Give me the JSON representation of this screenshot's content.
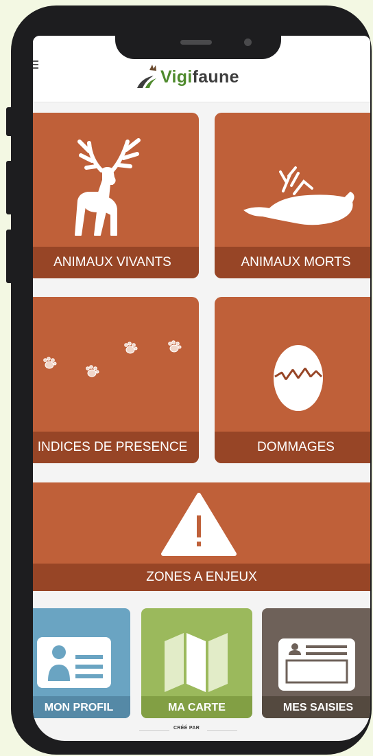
{
  "app": {
    "logo_prefix": "Vigi",
    "logo_suffix": "faune"
  },
  "tiles": {
    "animaux_vivants": "ANIMAUX VIVANTS",
    "animaux_morts": "ANIMAUX MORTS",
    "indices_presence": "INDICES DE PRESENCE",
    "dommages": "DOMMAGES",
    "zones_enjeux": "ZONES A ENJEUX"
  },
  "bottom_nav": {
    "mon_profil": "MON PROFIL",
    "ma_carte": "MA CARTE",
    "mes_saisies": "MES SAISIES"
  },
  "footer": {
    "credit": "CRÉÉ PAR"
  },
  "colors": {
    "tile": "#bf6039",
    "tile_label": "#974526",
    "profil": "#6aa4c2",
    "carte": "#9bb95c",
    "saisies": "#6e6159",
    "background": "#f3f8e3"
  },
  "icons": [
    "menu-icon",
    "deer-icon",
    "dead-bird-icon",
    "paw-prints-icon",
    "broken-egg-icon",
    "warning-icon",
    "profile-card-icon",
    "map-icon",
    "id-card-icon"
  ]
}
